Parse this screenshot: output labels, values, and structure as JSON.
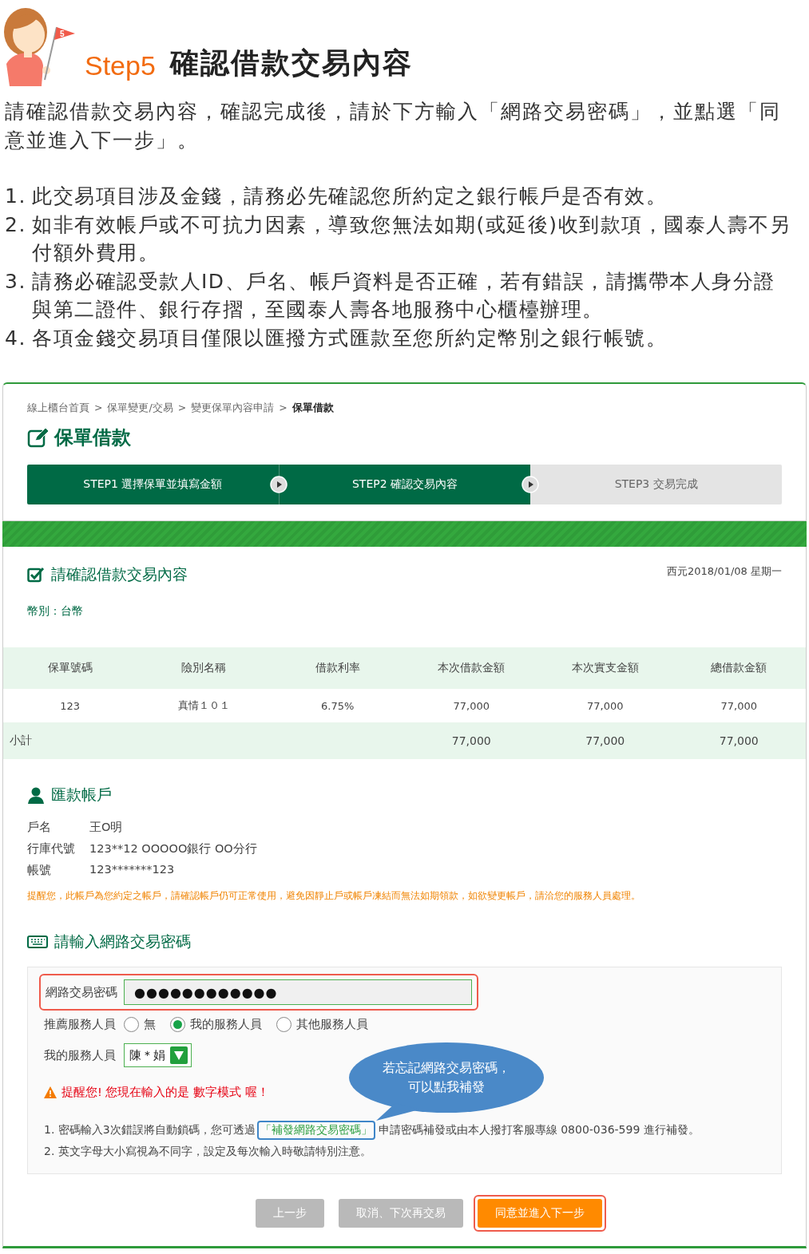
{
  "guide": {
    "flag_number": "5",
    "step_label": "Step5",
    "title": "確認借款交易內容",
    "intro": "請確認借款交易內容，確認完成後，請於下方輸入「網路交易密碼」，並點選「同意並進入下一步」。",
    "notes": [
      {
        "number": "1.",
        "text": "此交易項目涉及金錢，請務必先確認您所約定之銀行帳戶是否有效。"
      },
      {
        "number": "2.",
        "text": "如非有效帳戶或不可抗力因素，導致您無法如期(或延後)收到款項，國泰人壽不另付額外費用。"
      },
      {
        "number": "3.",
        "text": "請務必確認受款人ID、戶名、帳戶資料是否正確，若有錯誤，請攜帶本人身分證與第二證件、銀行存摺，至國泰人壽各地服務中心櫃檯辦理。"
      },
      {
        "number": "4.",
        "text": "各項金錢交易項目僅限以匯撥方式匯款至您所約定幣別之銀行帳號。"
      }
    ]
  },
  "screen": {
    "breadcrumb": [
      {
        "label": "線上櫃台首頁",
        "current": false
      },
      {
        "label": "保單變更/交易",
        "current": false
      },
      {
        "label": "變更保單內容申請",
        "current": false
      },
      {
        "label": "保單借款",
        "current": true
      }
    ],
    "separator": ">",
    "page_title": "保單借款",
    "steps": [
      {
        "label": "STEP1 選擇保單並填寫金額",
        "active": true
      },
      {
        "label": "STEP2 確認交易內容",
        "active": true
      },
      {
        "label": "STEP3 交易完成",
        "active": false
      }
    ],
    "confirm": {
      "title": "請確認借款交易內容",
      "date": "西元2018/01/08 星期一",
      "currency": "幣別：台幣",
      "table": {
        "columns": [
          "保單號碼",
          "險別名稱",
          "借款利率",
          "本次借款金額",
          "本次實支金額",
          "總借款金額"
        ],
        "rows": [
          [
            "123",
            "真情１０１",
            "6.75%",
            "77,000",
            "77,000",
            "77,000"
          ]
        ],
        "subtotal": {
          "label": "小計",
          "amounts": [
            "77,000",
            "77,000",
            "77,000"
          ]
        }
      }
    },
    "account": {
      "title": "匯款帳戶",
      "fields": [
        {
          "label": "戶名",
          "value": "王O明"
        },
        {
          "label": "行庫代號",
          "value": "123**12 OOOOO銀行 OO分行"
        },
        {
          "label": "帳號",
          "value": "123*******123"
        }
      ],
      "notice": "提醒您，此帳戶為您約定之帳戶，請確認帳戶仍可正常使用，避免因靜止戶或帳戶凍結而無法如期領款，如欲變更帳戶，請洽您的服務人員處理。"
    },
    "password": {
      "title": "請輸入網路交易密碼",
      "field": {
        "label": "網路交易密碼",
        "value": "●●●●●●●●●●●●",
        "highlighted": true
      },
      "referral": {
        "label": "推薦服務人員",
        "options": [
          {
            "label": "無",
            "selected": false
          },
          {
            "label": "我的服務人員",
            "selected": true
          },
          {
            "label": "其他服務人員",
            "selected": false
          }
        ]
      },
      "agent": {
        "label": "我的服務人員",
        "value": "陳＊娟"
      },
      "warning": "提醒您! 您現在輸入的是 數字模式 喔！",
      "notes": [
        {
          "before": "1. 密碼輸入3次錯誤將自動鎖碼，您可透過",
          "link": "「補發網路交易密碼」",
          "link_highlighted": true,
          "after": "申請密碼補發或由本人撥打客服專線 0800-036-599 進行補發。"
        },
        {
          "before": "2. 英文字母大小寫視為不同字，設定及每次輸入時敬請特別注意。"
        }
      ],
      "callout": [
        "若忘記網路交易密碼，",
        "可以點我補發"
      ]
    },
    "buttons": [
      {
        "label": "上一步",
        "kind": "secondary",
        "highlighted": false
      },
      {
        "label": "取消、下次再交易",
        "kind": "secondary",
        "highlighted": false
      },
      {
        "label": "同意並進入下一步",
        "kind": "primary",
        "highlighted": true
      }
    ]
  }
}
